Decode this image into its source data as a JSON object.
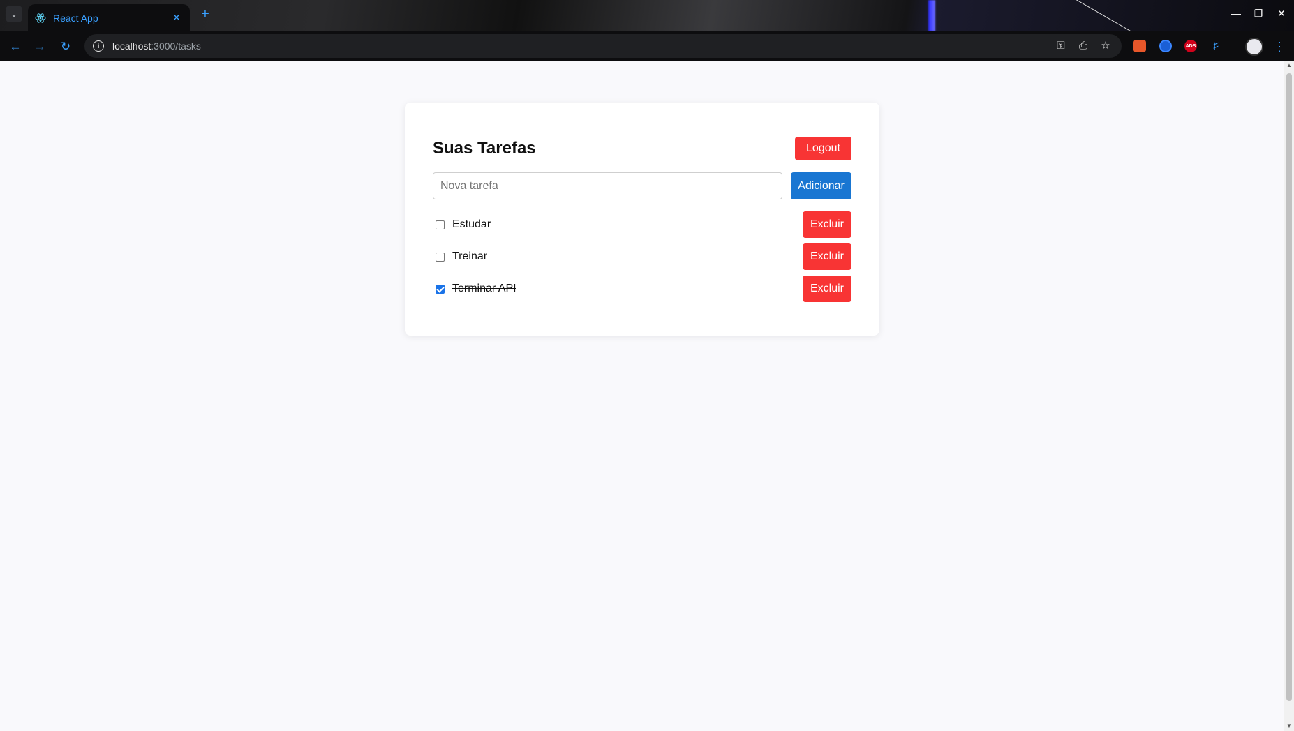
{
  "browser": {
    "tab_title": "React App",
    "url_host": "localhost",
    "url_path": ":3000/tasks",
    "ext_badge": "ADS"
  },
  "page": {
    "title": "Suas Tarefas",
    "logout_label": "Logout",
    "new_task_placeholder": "Nova tarefa",
    "add_label": "Adicionar",
    "tasks": [
      {
        "label": "Estudar",
        "done": false,
        "delete_label": "Excluir"
      },
      {
        "label": "Treinar",
        "done": false,
        "delete_label": "Excluir"
      },
      {
        "label": "Terminar API",
        "done": true,
        "delete_label": "Excluir"
      }
    ]
  },
  "colors": {
    "danger": "#f83434",
    "primary": "#1976d2",
    "tab_accent": "#3aa0ff"
  }
}
